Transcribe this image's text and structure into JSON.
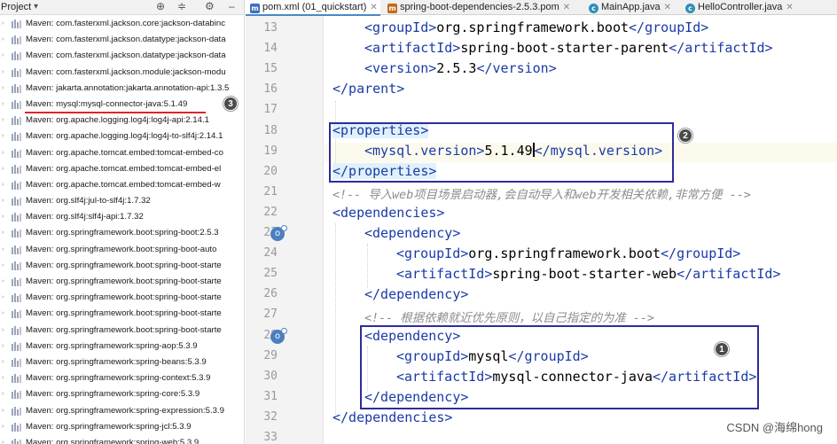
{
  "project_panel": {
    "title": "Project",
    "items": [
      "Maven: com.fasterxml.jackson.core:jackson-databinc",
      "Maven: com.fasterxml.jackson.datatype:jackson-data",
      "Maven: com.fasterxml.jackson.datatype:jackson-data",
      "Maven: com.fasterxml.jackson.module:jackson-modu",
      "Maven: jakarta.annotation:jakarta.annotation-api:1.3.5",
      "Maven: mysql:mysql-connector-java:5.1.49",
      "Maven: org.apache.logging.log4j:log4j-api:2.14.1",
      "Maven: org.apache.logging.log4j:log4j-to-slf4j:2.14.1",
      "Maven: org.apache.tomcat.embed:tomcat-embed-co",
      "Maven: org.apache.tomcat.embed:tomcat-embed-el",
      "Maven: org.apache.tomcat.embed:tomcat-embed-w",
      "Maven: org.slf4j:jul-to-slf4j:1.7.32",
      "Maven: org.slf4j:slf4j-api:1.7.32",
      "Maven: org.springframework.boot:spring-boot:2.5.3",
      "Maven: org.springframework.boot:spring-boot-auto",
      "Maven: org.springframework.boot:spring-boot-starte",
      "Maven: org.springframework.boot:spring-boot-starte",
      "Maven: org.springframework.boot:spring-boot-starte",
      "Maven: org.springframework.boot:spring-boot-starte",
      "Maven: org.springframework.boot:spring-boot-starte",
      "Maven: org.springframework:spring-aop:5.3.9",
      "Maven: org.springframework:spring-beans:5.3.9",
      "Maven: org.springframework:spring-context:5.3.9",
      "Maven: org.springframework:spring-core:5.3.9",
      "Maven: org.springframework:spring-expression:5.3.9",
      "Maven: org.springframework:spring-jcl:5.3.9",
      "Maven: org.springframework:spring-web:5.3.9"
    ]
  },
  "tabs": [
    {
      "label": "pom.xml (01_quickstart)",
      "icon": "m"
    },
    {
      "label": "spring-boot-dependencies-2.5.3.pom",
      "icon": "m"
    },
    {
      "label": "MainApp.java",
      "icon": "c"
    },
    {
      "label": "HelloController.java",
      "icon": "c"
    }
  ],
  "editor": {
    "line_numbers": [
      "13",
      "14",
      "15",
      "16",
      "17",
      "18",
      "19",
      "20",
      "21",
      "22",
      "23",
      "24",
      "25",
      "26",
      "27",
      "28",
      "29",
      "30",
      "31",
      "32",
      "33"
    ],
    "code": {
      "l13_open": "<groupId>",
      "l13_val": "org.springframework.boot",
      "l13_close": "</groupId>",
      "l14_open": "<artifactId>",
      "l14_val": "spring-boot-starter-parent",
      "l14_close": "</artifactId>",
      "l15_open": "<version>",
      "l15_val": "2.5.3",
      "l15_close": "</version>",
      "l16": "</parent>",
      "l18": "<properties>",
      "l19_open": "<mysql.version>",
      "l19_val": "5.1.49",
      "l19_close": "</mysql.version>",
      "l20": "</properties>",
      "l21": "<!-- 导入web项目场景启动器,会自动导入和web开发相关依赖,非常方便 -->",
      "l22": "<dependencies>",
      "l23": "<dependency>",
      "l24_open": "<groupId>",
      "l24_val": "org.springframework.boot",
      "l24_close": "</groupId>",
      "l25_open": "<artifactId>",
      "l25_val": "spring-boot-starter-web",
      "l25_close": "</artifactId>",
      "l26": "</dependency>",
      "l27": "<!-- 根据依赖就近优先原则，以自己指定的为准 -->",
      "l28": "<dependency>",
      "l29_open": "<groupId>",
      "l29_val": "mysql",
      "l29_close": "</groupId>",
      "l30_open": "<artifactId>",
      "l30_val": "mysql-connector-java",
      "l30_close": "</artifactId>",
      "l31": "</dependency>",
      "l32": "</dependencies>"
    }
  },
  "annotations": {
    "badge1": "1",
    "badge2": "2",
    "badge3": "3"
  },
  "watermark": "CSDN @海绵hong",
  "colors": {
    "tag": "#1a3aa8",
    "comment": "#8c8c8c",
    "annotation_box": "#2d2d9b",
    "underline": "#e0242b"
  }
}
